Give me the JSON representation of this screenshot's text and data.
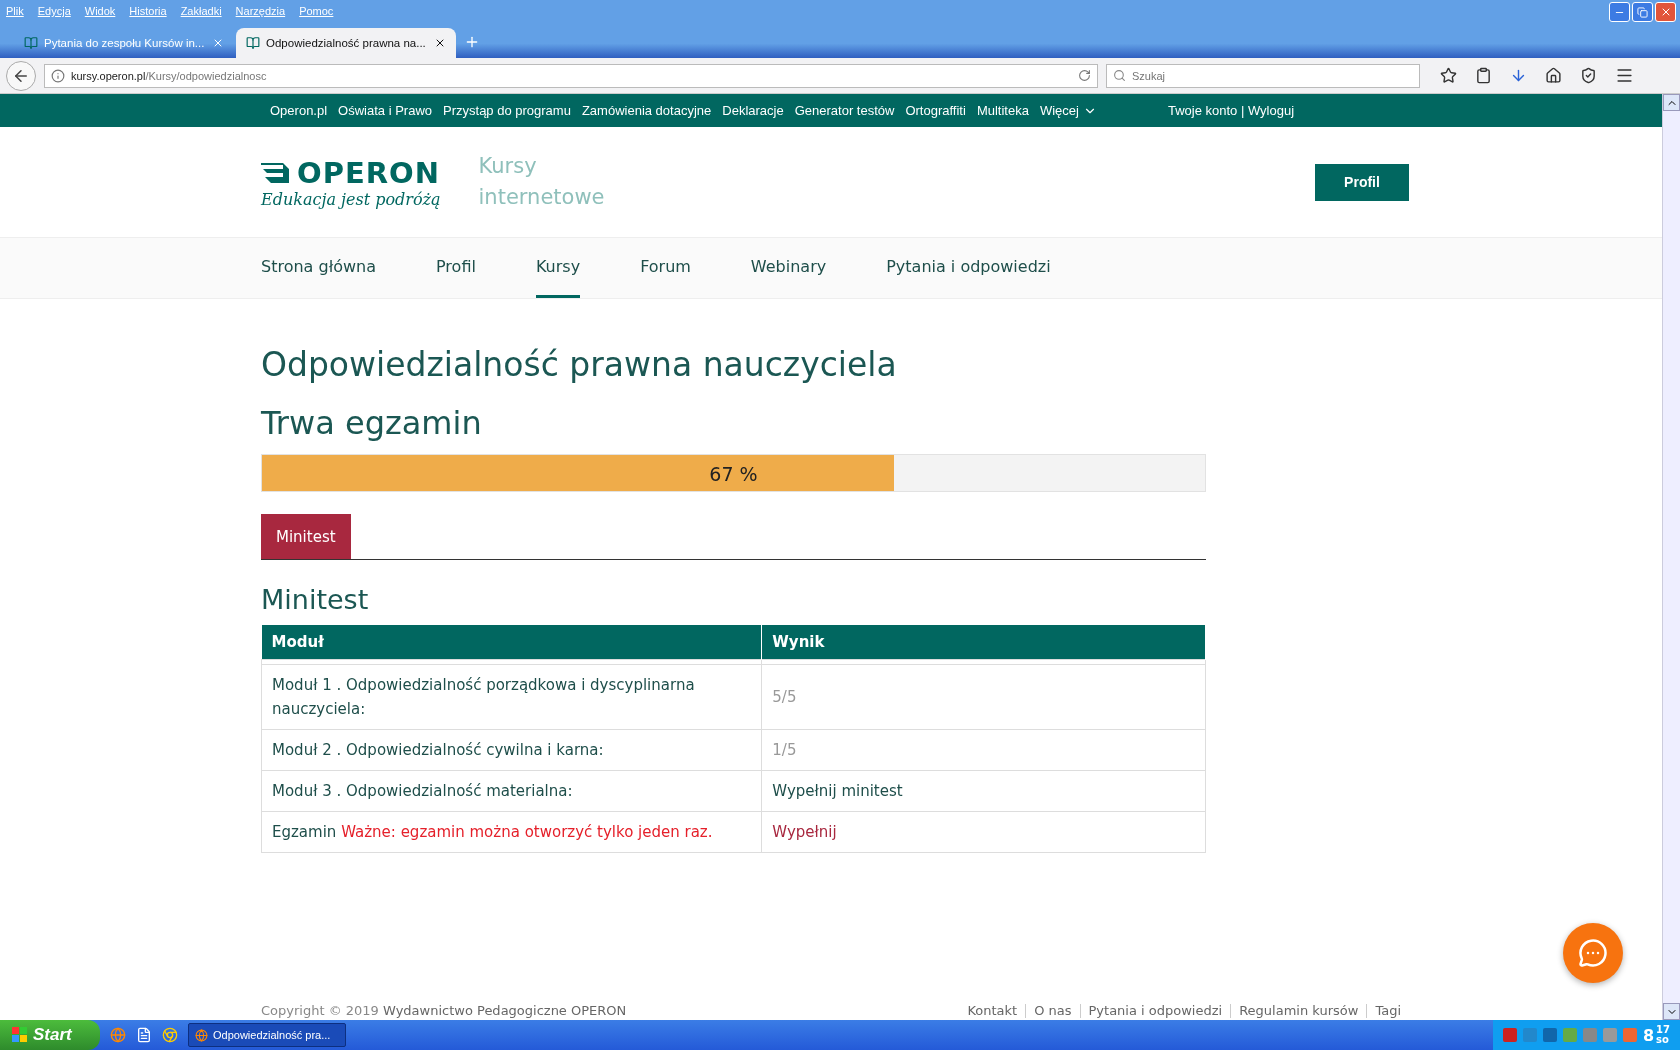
{
  "menu_bar": [
    "Plik",
    "Edycja",
    "Widok",
    "Historia",
    "Zakładki",
    "Narzędzia",
    "Pomoc"
  ],
  "browser_tabs": [
    {
      "title": "Pytania do zespołu Kursów in...",
      "selected": false
    },
    {
      "title": "Odpowiedzialność prawna na...",
      "selected": true
    }
  ],
  "address_bar": {
    "host": "kursy.operon.pl",
    "path": "/Kursy/odpowiedzialnosc"
  },
  "search": {
    "placeholder": "Szukaj"
  },
  "site_top_nav": {
    "items": [
      "Operon.pl",
      "Oświata i Prawo",
      "Przystąp do programu",
      "Zamówienia dotacyjne",
      "Deklaracje",
      "Generator testów",
      "Ortograffiti",
      "Multiteka",
      "Więcej"
    ],
    "account": "Twoje konto | Wyloguj"
  },
  "header": {
    "logo": "OPERON",
    "slogan": "Edukacja jest podróżą",
    "subtitle": "Kursy internetowe",
    "profile_button": "Profil"
  },
  "main_nav": [
    {
      "label": "Strona główna",
      "selected": false
    },
    {
      "label": "Profil",
      "selected": false
    },
    {
      "label": "Kursy",
      "selected": true
    },
    {
      "label": "Forum",
      "selected": false
    },
    {
      "label": "Webinary",
      "selected": false
    },
    {
      "label": "Pytania i odpowiedzi",
      "selected": false
    }
  ],
  "course_title": "Odpowiedzialność prawna nauczyciela",
  "exam_status": "Trwa egzamin",
  "progress": {
    "level": 0.67,
    "label": "67 %"
  },
  "section_tabs": [
    {
      "label": "Minitest",
      "selected": true
    }
  ],
  "section_title": "Minitest",
  "table": {
    "columns": [
      "Moduł",
      "Wynik"
    ],
    "rows": [
      {
        "module": "Moduł 1 . Odpowiedzialność porządkowa i dyscyplinarna nauczyciela:",
        "result": "5/5",
        "kind": "score"
      },
      {
        "module": "Moduł 2 . Odpowiedzialność cywilna i karna:",
        "result": "1/5",
        "kind": "score"
      },
      {
        "module": "Moduł 3 . Odpowiedzialność materialna:",
        "result": "Wypełnij minitest",
        "kind": "link"
      },
      {
        "module": "Egzamin",
        "warning": "Ważne: egzamin można otworzyć tylko jeden raz.",
        "result": "Wypełnij",
        "kind": "exam"
      }
    ]
  },
  "footer": {
    "copyright": "Copyright © 2019",
    "publisher": "Wydawnictwo Pedagogiczne OPERON",
    "links": [
      "Kontakt",
      "O nas",
      "Pytania i odpowiedzi",
      "Regulamin kursów",
      "Tagi"
    ]
  },
  "taskbar": {
    "start": "Start",
    "window": "Odpowiedzialność pra...",
    "clock_hour": "8",
    "clock_minutes": "17",
    "clock_day": "so"
  }
}
